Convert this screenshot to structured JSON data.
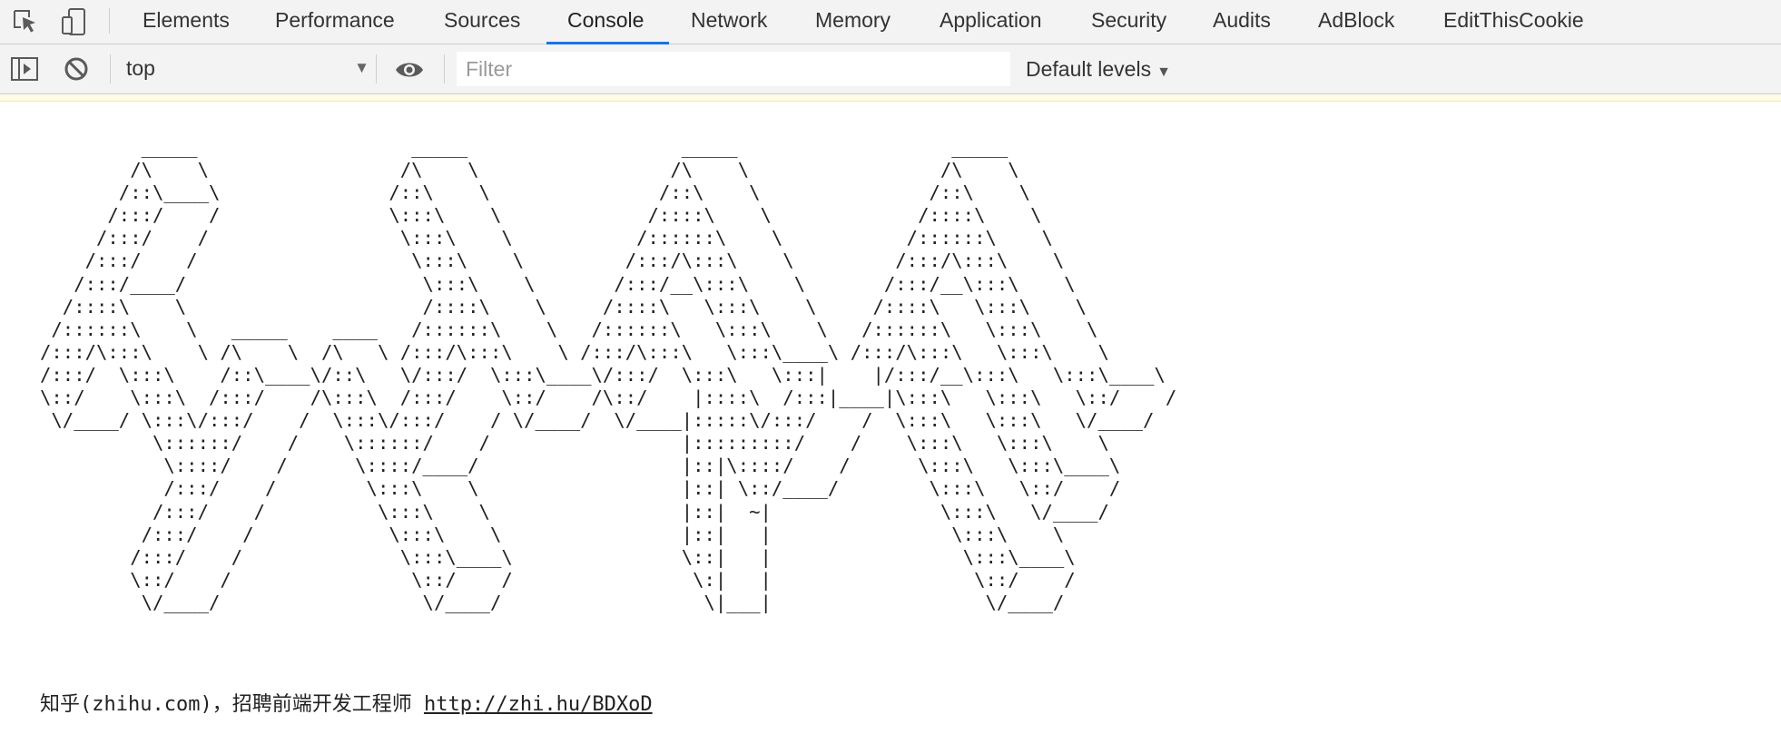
{
  "devtools": {
    "tabs": [
      {
        "label": "Elements",
        "active": false
      },
      {
        "label": "Performance",
        "active": false
      },
      {
        "label": "Sources",
        "active": false
      },
      {
        "label": "Console",
        "active": true
      },
      {
        "label": "Network",
        "active": false
      },
      {
        "label": "Memory",
        "active": false
      },
      {
        "label": "Application",
        "active": false
      },
      {
        "label": "Security",
        "active": false
      },
      {
        "label": "Audits",
        "active": false
      },
      {
        "label": "AdBlock",
        "active": false
      },
      {
        "label": "EditThisCookie",
        "active": false
      }
    ],
    "accent_color": "#1a73e8",
    "icons": [
      "inspect-element-icon",
      "device-toolbar-icon"
    ]
  },
  "toolbar": {
    "context": "top",
    "context_arrow": "▼",
    "filter_placeholder": "Filter",
    "filter_value": "",
    "levels_label": "Default levels",
    "levels_arrow": "▼",
    "icons": [
      "sidebar-toggle-icon",
      "clear-console-icon",
      "live-expression-eye-icon"
    ]
  },
  "console": {
    "ascii_art": "         _____                   _____                   _____                   _____\n        /\\    \\                 /\\    \\                 /\\    \\                 /\\    \\\n       /::\\____\\               /::\\    \\               /::\\    \\               /::\\    \\\n      /:::/    /               \\:::\\    \\             /::::\\    \\             /::::\\    \\\n     /:::/    /                 \\:::\\    \\           /::::::\\    \\           /::::::\\    \\\n    /:::/    /                   \\:::\\    \\         /:::/\\:::\\    \\         /:::/\\:::\\    \\\n   /:::/____/                     \\:::\\    \\       /:::/__\\:::\\    \\       /:::/__\\:::\\    \\\n  /::::\\    \\                     /::::\\    \\     /::::\\   \\:::\\    \\     /::::\\   \\:::\\    \\\n /::::::\\    \\   _____    ____   /::::::\\    \\   /::::::\\   \\:::\\    \\   /::::::\\   \\:::\\    \\\n/:::/\\:::\\    \\ /\\    \\  /\\   \\ /:::/\\:::\\    \\ /:::/\\:::\\   \\:::\\____\\ /:::/\\:::\\   \\:::\\    \\\n/:::/  \\:::\\    /::\\____\\/::\\   \\/:::/  \\:::\\____\\/:::/  \\:::\\   \\:::|    |/:::/__\\:::\\   \\:::\\____\\\n\\::/    \\:::\\  /:::/    /\\:::\\  /:::/    \\::/    /\\::/    |::::\\  /:::|____|\\:::\\   \\:::\\   \\::/    /\n \\/____/ \\:::\\/:::/    /  \\:::\\/:::/    / \\/____/  \\/____|:::::\\/:::/    /  \\:::\\   \\:::\\   \\/____/\n          \\::::::/    /    \\::::::/    /                 |:::::::::/    /    \\:::\\   \\:::\\    \\\n           \\::::/    /      \\::::/____/                  |::|\\::::/    /      \\:::\\   \\:::\\____\\\n           /:::/    /        \\:::\\    \\                  |::| \\::/____/        \\:::\\   \\::/    /\n          /:::/    /          \\:::\\    \\                 |::|  ~|               \\:::\\   \\/____/\n         /:::/    /            \\:::\\    \\                |::|   |                \\:::\\    \\\n        /:::/    /              \\:::\\____\\               \\::|   |                 \\:::\\____\\\n        \\::/    /                \\::/    /                \\:|   |                  \\::/    /\n         \\/____/                  \\/____/                  \\|___|                   \\/____/",
    "message_prefix": "知乎(zhihu.com)，招聘前端开发工程师 ",
    "link_text": "http://zhi.hu/BDXoD"
  }
}
